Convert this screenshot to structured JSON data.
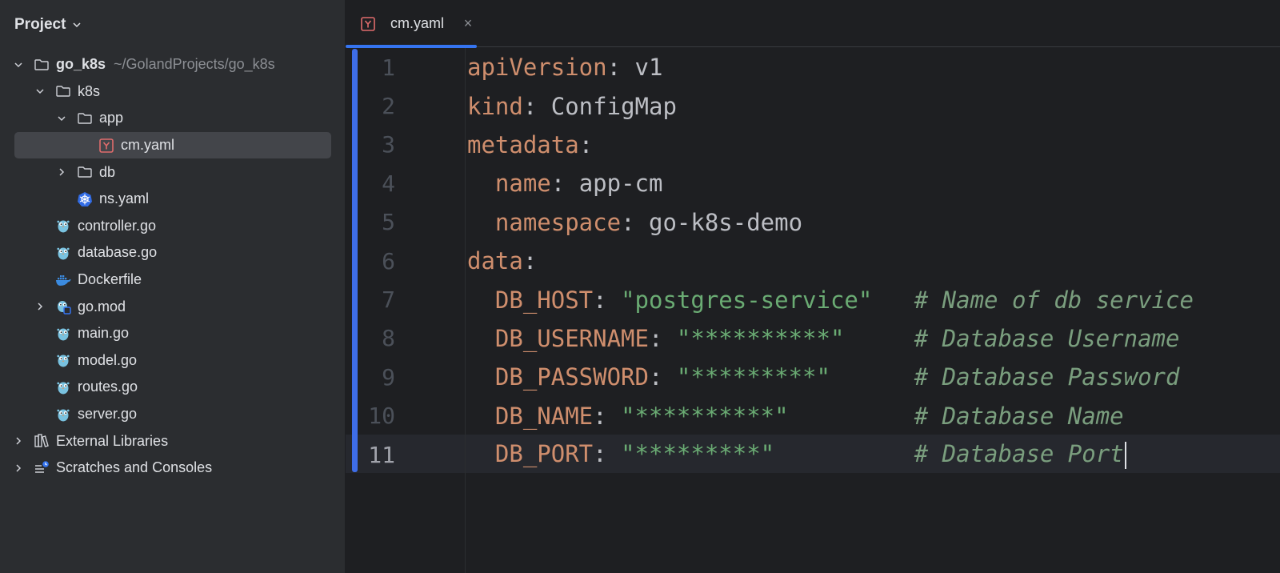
{
  "sidebar": {
    "title": "Project",
    "tree": [
      {
        "label": "go_k8s",
        "hint": "~/GolandProjects/go_k8s",
        "level": 0,
        "arrow": "down",
        "icon": "folder-icon",
        "bold": true
      },
      {
        "label": "k8s",
        "level": 1,
        "arrow": "down",
        "icon": "folder-icon"
      },
      {
        "label": "app",
        "level": 2,
        "arrow": "down",
        "icon": "folder-icon"
      },
      {
        "label": "cm.yaml",
        "level": 3,
        "arrow": "none",
        "icon": "yaml-file-icon",
        "selected": true
      },
      {
        "label": "db",
        "level": 2,
        "arrow": "right",
        "icon": "folder-icon"
      },
      {
        "label": "ns.yaml",
        "level": 2,
        "arrow": "none",
        "icon": "kubernetes-icon"
      },
      {
        "label": "controller.go",
        "level": 1,
        "arrow": "none",
        "icon": "go-file-icon"
      },
      {
        "label": "database.go",
        "level": 1,
        "arrow": "none",
        "icon": "go-file-icon"
      },
      {
        "label": "Dockerfile",
        "level": 1,
        "arrow": "none",
        "icon": "docker-icon"
      },
      {
        "label": "go.mod",
        "level": 1,
        "arrow": "right",
        "icon": "go-mod-icon"
      },
      {
        "label": "main.go",
        "level": 1,
        "arrow": "none",
        "icon": "go-file-icon"
      },
      {
        "label": "model.go",
        "level": 1,
        "arrow": "none",
        "icon": "go-file-icon"
      },
      {
        "label": "routes.go",
        "level": 1,
        "arrow": "none",
        "icon": "go-file-icon"
      },
      {
        "label": "server.go",
        "level": 1,
        "arrow": "none",
        "icon": "go-file-icon"
      },
      {
        "label": "External Libraries",
        "level": 0,
        "arrow": "right",
        "icon": "library-icon"
      },
      {
        "label": "Scratches and Consoles",
        "level": 0,
        "arrow": "right",
        "icon": "scratches-icon"
      }
    ]
  },
  "tab": {
    "label": "cm.yaml",
    "close": "×"
  },
  "editor": {
    "current_line": 11,
    "lines": [
      {
        "num": "1",
        "indent": "",
        "key": "apiVersion",
        "sep": ": ",
        "value": "v1",
        "string": "",
        "comment": ""
      },
      {
        "num": "2",
        "indent": "",
        "key": "kind",
        "sep": ": ",
        "value": "ConfigMap",
        "string": "",
        "comment": ""
      },
      {
        "num": "3",
        "indent": "",
        "key": "metadata",
        "sep": ":",
        "value": "",
        "string": "",
        "comment": ""
      },
      {
        "num": "4",
        "indent": "  ",
        "key": "name",
        "sep": ": ",
        "value": "app-cm",
        "string": "",
        "comment": ""
      },
      {
        "num": "5",
        "indent": "  ",
        "key": "namespace",
        "sep": ": ",
        "value": "go-k8s-demo",
        "string": "",
        "comment": ""
      },
      {
        "num": "6",
        "indent": "",
        "key": "data",
        "sep": ":",
        "value": "",
        "string": "",
        "comment": ""
      },
      {
        "num": "7",
        "indent": "  ",
        "key": "DB_HOST",
        "sep": ": ",
        "value": "",
        "string": "\"postgres-service\"",
        "pad": "   ",
        "comment": "# Name of db service"
      },
      {
        "num": "8",
        "indent": "  ",
        "key": "DB_USERNAME",
        "sep": ": ",
        "value": "",
        "string": "\"**********\"",
        "pad": "     ",
        "comment": "# Database Username"
      },
      {
        "num": "9",
        "indent": "  ",
        "key": "DB_PASSWORD",
        "sep": ": ",
        "value": "",
        "string": "\"*********\"",
        "pad": "      ",
        "comment": "# Database Password"
      },
      {
        "num": "10",
        "indent": "  ",
        "key": "DB_NAME",
        "sep": ": ",
        "value": "",
        "string": "\"**********\"",
        "pad": "         ",
        "comment": "# Database Name"
      },
      {
        "num": "11",
        "indent": "  ",
        "key": "DB_PORT",
        "sep": ": ",
        "value": "",
        "string": "\"*********\"",
        "pad": "          ",
        "comment": "# Database Port"
      }
    ]
  },
  "colors": {
    "key": "#cf8e6d",
    "string": "#6aab73",
    "comment": "#7a9e7e",
    "accent": "#3574f0"
  }
}
